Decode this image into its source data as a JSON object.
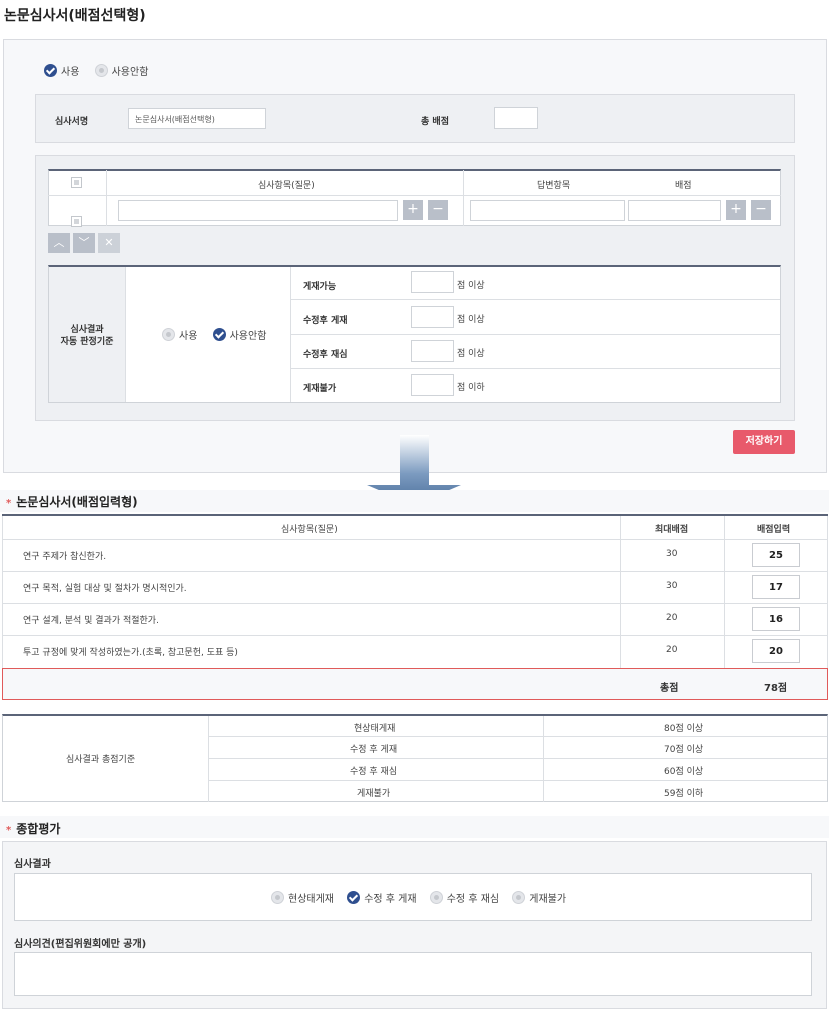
{
  "page_title": "논문심사서(배점선택형)",
  "usage": {
    "use_label": "사용",
    "unuse_label": "사용안함"
  },
  "header_form": {
    "name_label": "심사서명",
    "name_value": "논문심사서(배점선택형)",
    "total_label": "총 배점",
    "total_value": ""
  },
  "question_table": {
    "col_question": "심사항목(질문)",
    "col_answer": "답변항목",
    "col_score": "배점"
  },
  "auto_judge": {
    "label_line1": "심사결과",
    "label_line2": "자동 판정기준",
    "use_label": "사용",
    "unuse_label": "사용안함",
    "rows": [
      {
        "label": "게재가능",
        "suffix": "점 이상"
      },
      {
        "label": "수정후 게재",
        "suffix": "점 이상"
      },
      {
        "label": "수정후 재심",
        "suffix": "점 이상"
      },
      {
        "label": "게재불가",
        "suffix": "점 이하"
      }
    ]
  },
  "save_button": "저장하기",
  "input_section": {
    "title": "논문심사서(배점입력형)",
    "col_question": "심사항목(질문)",
    "col_max": "최대배점",
    "col_input": "배점입력",
    "rows": [
      {
        "question": "연구 주제가 참신한가.",
        "max": "30",
        "score": "25"
      },
      {
        "question": "연구 목적, 실험 대상 및 절차가 명시적인가.",
        "max": "30",
        "score": "17"
      },
      {
        "question": "연구 설계, 분석 및 결과가 적절한가.",
        "max": "20",
        "score": "16"
      },
      {
        "question": "투고 규정에 맞게 작성하였는가.(초록, 참고문헌, 도표 등)",
        "max": "20",
        "score": "20"
      }
    ],
    "total_label": "총점",
    "total_value": "78점"
  },
  "criteria": {
    "label": "심사결과 총점기준",
    "rows": [
      {
        "name": "현상태게재",
        "value": "80점 이상"
      },
      {
        "name": "수정 후 게재",
        "value": "70점 이상"
      },
      {
        "name": "수정 후 재심",
        "value": "60점 이상"
      },
      {
        "name": "게재불가",
        "value": "59점 이하"
      }
    ]
  },
  "overall": {
    "title": "종합평가",
    "result_label": "심사결과",
    "options": [
      "현상태게재",
      "수정 후 게재",
      "수정 후 재심",
      "게재불가"
    ],
    "selected": "수정 후 게재",
    "opinion_label": "심사의견(편집위원회에만 공개)"
  },
  "colors": {
    "accent": "#2f4f8f",
    "save": "#e85a6b",
    "highlight_border": "#e05a5a"
  }
}
